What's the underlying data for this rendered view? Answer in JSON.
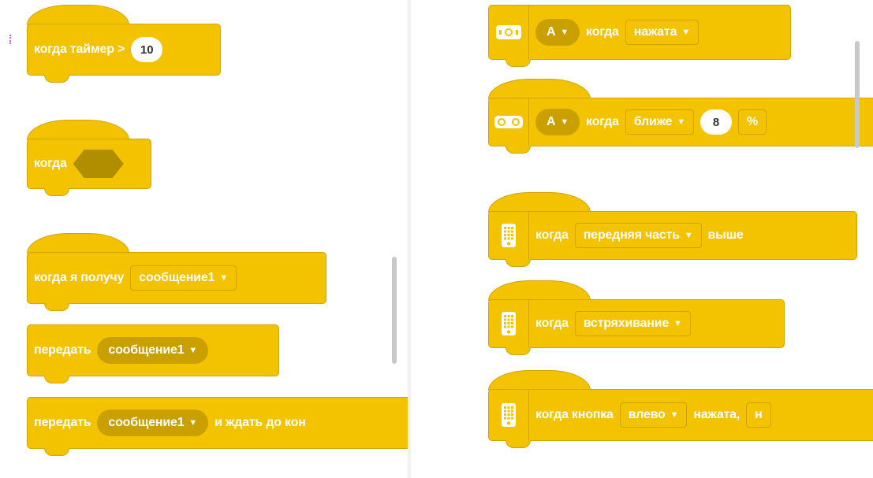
{
  "left_palette": {
    "timer_hat": {
      "label": "когда таймер >",
      "value": "10"
    },
    "when_hat": {
      "label": "когда"
    },
    "receive_hat": {
      "label": "когда я получу",
      "message": "сообщение1"
    },
    "broadcast": {
      "label": "передать",
      "message": "сообщение1"
    },
    "broadcast_wait": {
      "label": "передать",
      "message": "сообщение1",
      "suffix": "и ждать до кон"
    }
  },
  "right_palette": {
    "button_hat": {
      "port": "A",
      "label": "когда",
      "state": "нажата"
    },
    "distance_hat": {
      "port": "A",
      "label": "когда",
      "compare": "ближе",
      "value": "8",
      "unit_partial": "%"
    },
    "tilt_hat": {
      "label": "когда",
      "side": "передняя часть",
      "direction": "выше"
    },
    "shake_hat": {
      "label": "когда",
      "gesture": "встряхивание"
    },
    "hub_button_hat": {
      "label": "когда кнопка",
      "button": "влево",
      "state": "нажата,",
      "extra_partial": "н"
    }
  },
  "icons": {
    "button_sensor": "force-sensor-icon",
    "distance_sensor": "distance-sensor-icon",
    "hub": "hub-icon",
    "dropdown": "dropdown-caret-icon"
  },
  "colors": {
    "block": "#f3c200",
    "block_border": "#d4a400",
    "pill": "#caa000",
    "hex": "#b08e00"
  }
}
